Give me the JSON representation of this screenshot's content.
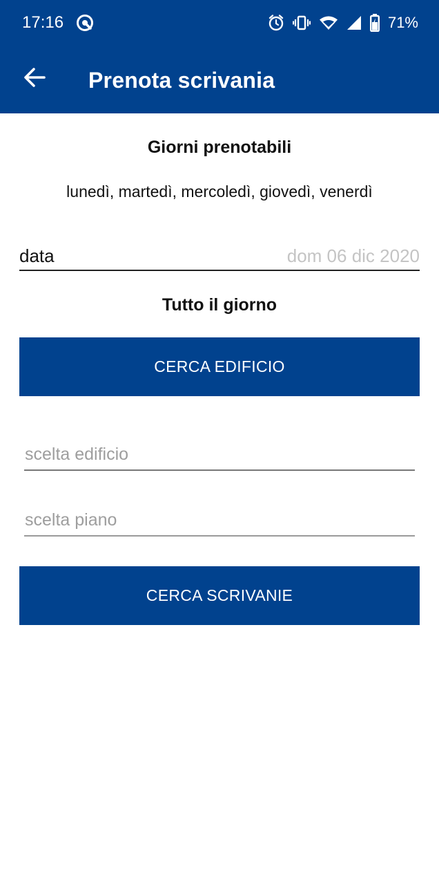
{
  "status_bar": {
    "time": "17:16",
    "battery": "71%",
    "icons": [
      "vpn-key-icon",
      "alarm-icon",
      "vibrate-icon",
      "wifi-icon",
      "signal-icon",
      "battery-charging-icon"
    ]
  },
  "app_bar": {
    "title": "Prenota scrivania",
    "back_icon": "arrow-left-icon"
  },
  "booking": {
    "days_title": "Giorni prenotabili",
    "days_list": "lunedì, martedì, mercoledì, giovedì, venerdì",
    "date_label": "data",
    "date_value": "dom 06 dic 2020",
    "time_slot": "Tutto il giorno",
    "search_building_label": "CERCA EDIFICIO",
    "building_placeholder": "scelta edificio",
    "floor_placeholder": "scelta piano",
    "search_desks_label": "CERCA SCRIVANIE"
  },
  "colors": {
    "primary": "#01428e",
    "placeholder": "#9e9e9e",
    "date_value": "#c4c4c4"
  }
}
